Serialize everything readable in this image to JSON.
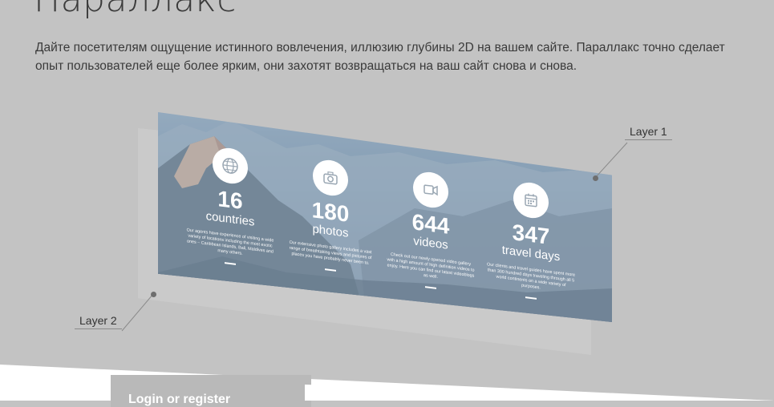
{
  "page": {
    "title": "Параллакс",
    "description": "Дайте посетителям ощущение истинного вовлечения, иллюзию глубины 2D на вашем сайте. Параллакс точно сделает опыт пользователей еще более ярким, они захотят возвращаться на ваш сайт снова и снова."
  },
  "diagram": {
    "layer1_label": "Layer 1",
    "layer2_label": "Layer 2",
    "stats": [
      {
        "icon": "globe-icon",
        "number": "16",
        "label": "countries",
        "text": "Our agents have experience of visiting a wide variety of locations including the most exotic ones – Caribbean Islands, Bali, Maldives and many others."
      },
      {
        "icon": "camera-icon",
        "number": "180",
        "label": "photos",
        "text": "Our extensive photo gallery includes a vast range of breathtaking views and pictures of places you have probably never been to."
      },
      {
        "icon": "video-camera-icon",
        "number": "644",
        "label": "videos",
        "text": "Check out our newly opened video gallery with a high amount of high definition videos to enjoy. Here you can find our latest videoblogs as well."
      },
      {
        "icon": "calendar-icon",
        "number": "347",
        "label": "travel days",
        "text": "Our clients and travel guides have spent more than 300 hundred days traveling through all 5 world continents on a wide variety of purposes."
      }
    ]
  },
  "login": {
    "title": "Login or register"
  },
  "colors": {
    "background": "#c3c3c3",
    "icon_circle": "#ffffff",
    "icon_stroke": "#9aa7b3"
  }
}
